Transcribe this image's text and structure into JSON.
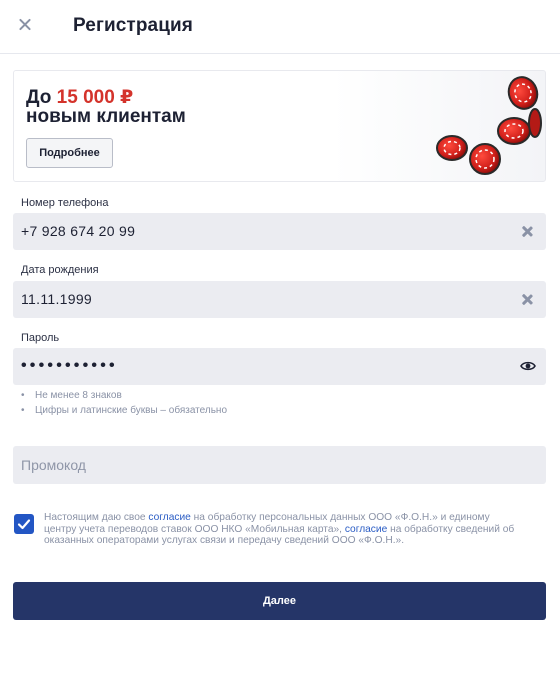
{
  "header": {
    "title": "Регистрация"
  },
  "banner": {
    "prefix": "До",
    "amount": "15 000 ₽",
    "line2": "новым клиентам",
    "button_label": "Подробнее"
  },
  "form": {
    "phone": {
      "label": "Номер телефона",
      "value": "+7 928 674 20 99"
    },
    "birthdate": {
      "label": "Дата рождения",
      "value": "11.11.1999"
    },
    "password": {
      "label": "Пароль",
      "masked_value": "•••••••••••"
    },
    "hints": [
      {
        "bullet": "•",
        "text": "Не менее 8 знаков"
      },
      {
        "bullet": "•",
        "text": "Цифры и латинские буквы – обязательно"
      }
    ],
    "promo": {
      "placeholder": "Промокод"
    }
  },
  "consent": {
    "checked": true,
    "part1": "Настоящим даю свое ",
    "link1": "согласие",
    "part2": " на обработку персональных данных ООО «Ф.О.Н.» и единому центру учета переводов ставок ООО НКО «Мобильная карта», ",
    "link2": "согласие",
    "part3": " на обработку сведений об оказанных операторами услугах связи и передачу сведений ООО «Ф.О.Н.»."
  },
  "submit": {
    "label": "Далее"
  },
  "colors": {
    "accent_red": "#d4332b",
    "primary_button": "#253568",
    "checkbox": "#2356c4",
    "link": "#2a5cc4",
    "field_bg": "#ebecf1"
  },
  "icons": {
    "close": "close-icon",
    "clear": "clear-icon",
    "eye": "eye-icon",
    "check": "checkmark-icon"
  }
}
